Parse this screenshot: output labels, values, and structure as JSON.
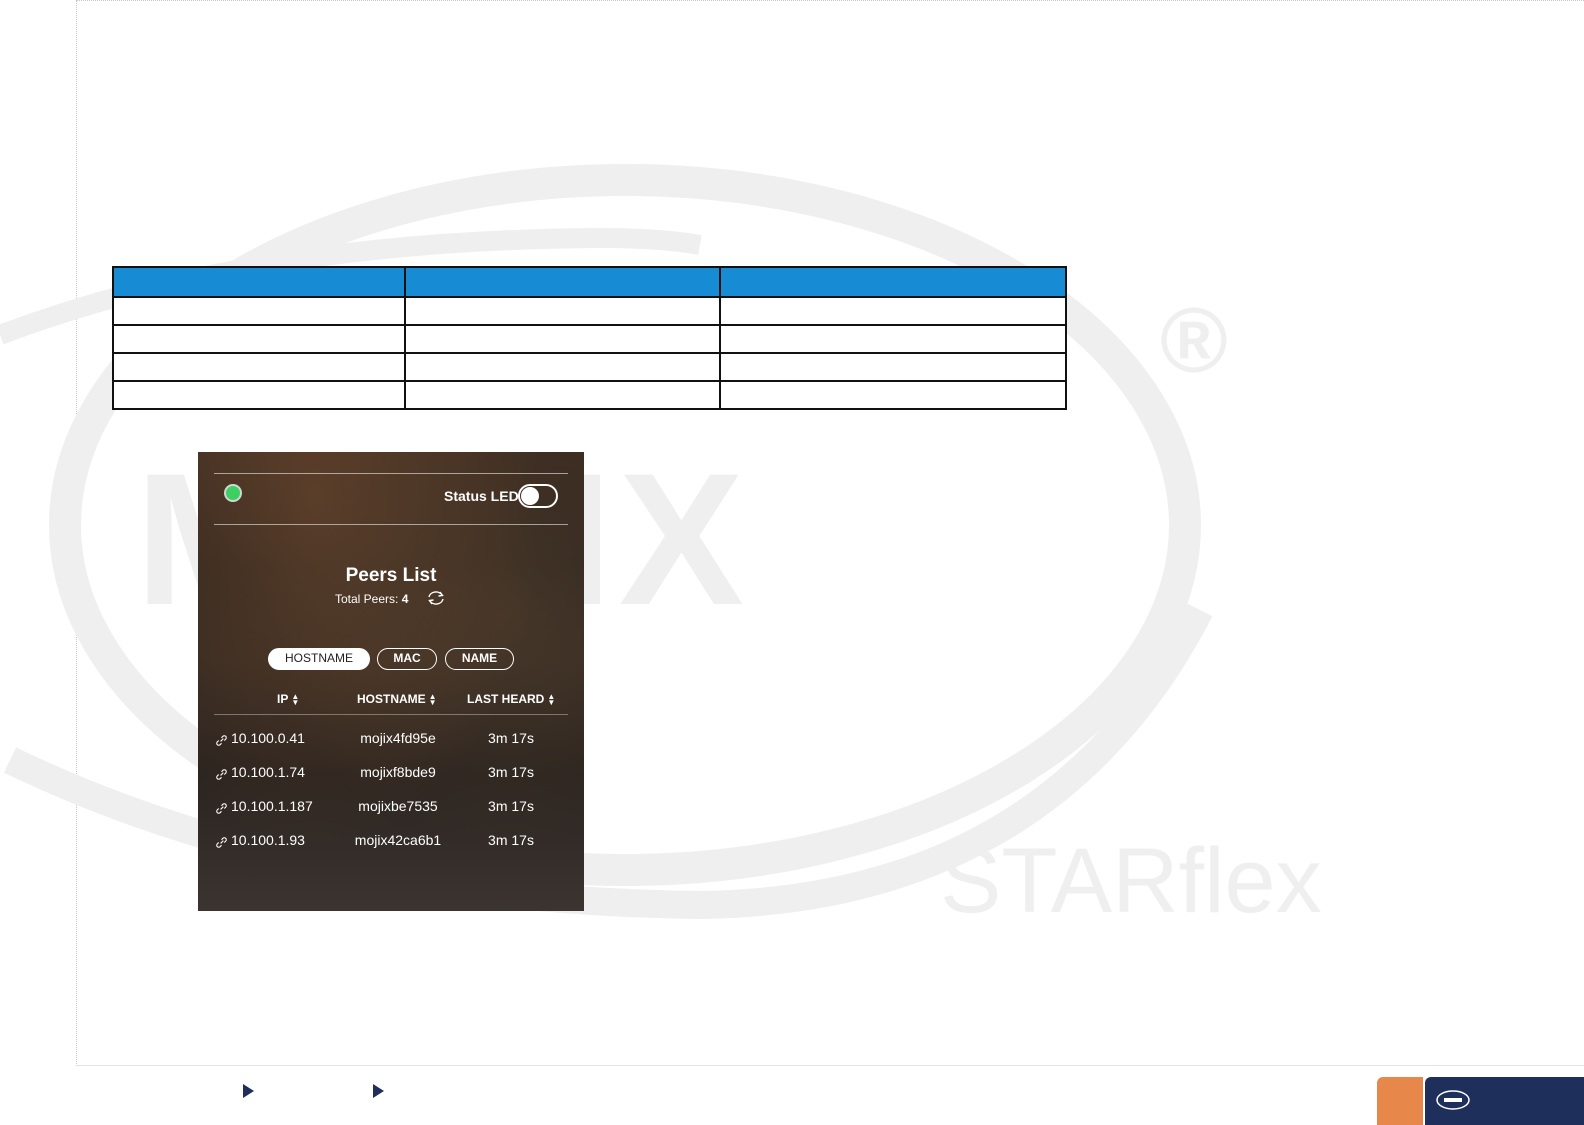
{
  "watermark": {
    "brand": "MOJIX",
    "registered": "®",
    "product": "STARflex"
  },
  "table": {
    "header_color": "#178bd4",
    "headers": [
      "",
      "",
      ""
    ],
    "rows": [
      [
        "",
        "",
        ""
      ],
      [
        "",
        "",
        ""
      ],
      [
        "",
        "",
        ""
      ],
      [
        "",
        "",
        ""
      ]
    ]
  },
  "panel": {
    "status_led_label": "Status LED",
    "status_led_on": false,
    "led_color": "#3ecf63",
    "peers_title": "Peers List",
    "total_label": "Total Peers:",
    "total_count": "4",
    "filters": [
      {
        "label": "HOSTNAME",
        "active": true
      },
      {
        "label": "MAC",
        "active": false
      },
      {
        "label": "NAME",
        "active": false
      }
    ],
    "columns": [
      "IP",
      "HOSTNAME",
      "LAST HEARD"
    ],
    "peers": [
      {
        "ip": "10.100.0.41",
        "hostname": "mojix4fd95e",
        "last_heard": "3m 17s"
      },
      {
        "ip": "10.100.1.74",
        "hostname": "mojixf8bde9",
        "last_heard": "3m 17s"
      },
      {
        "ip": "10.100.1.187",
        "hostname": "mojixbe7535",
        "last_heard": "3m 17s"
      },
      {
        "ip": "10.100.1.93",
        "hostname": "mojix42ca6b1",
        "last_heard": "3m 17s"
      }
    ]
  },
  "footer": {
    "accent_color": "#e8874a",
    "brand_color": "#1f2f5c"
  }
}
